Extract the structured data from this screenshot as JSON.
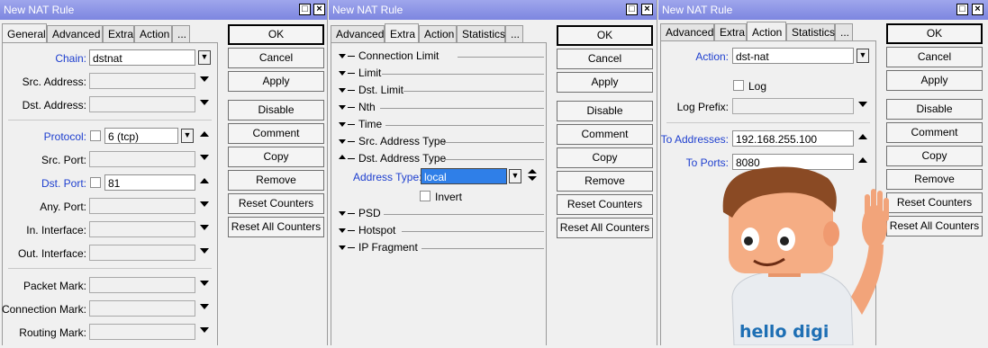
{
  "windows": [
    {
      "title": "New NAT Rule",
      "tabs": [
        "General",
        "Advanced",
        "Extra",
        "Action",
        "..."
      ],
      "active_tab": "General",
      "fields": {
        "chain": {
          "label": "Chain:",
          "value": "dstnat"
        },
        "src_address": {
          "label": "Src. Address:",
          "value": ""
        },
        "dst_address": {
          "label": "Dst. Address:",
          "value": ""
        },
        "protocol": {
          "label": "Protocol:",
          "value": "6 (tcp)"
        },
        "src_port": {
          "label": "Src. Port:",
          "value": ""
        },
        "dst_port": {
          "label": "Dst. Port:",
          "value": "81"
        },
        "any_port": {
          "label": "Any. Port:",
          "value": ""
        },
        "in_interface": {
          "label": "In. Interface:",
          "value": ""
        },
        "out_interface": {
          "label": "Out. Interface:",
          "value": ""
        },
        "packet_mark": {
          "label": "Packet Mark:",
          "value": ""
        },
        "connection_mark": {
          "label": "Connection Mark:",
          "value": ""
        },
        "routing_mark": {
          "label": "Routing Mark:",
          "value": ""
        }
      }
    },
    {
      "title": "New NAT Rule",
      "tabs": [
        "Advanced",
        "Extra",
        "Action",
        "Statistics",
        "..."
      ],
      "active_tab": "Extra",
      "sections": [
        "Connection Limit",
        "Limit",
        "Dst. Limit",
        "Nth",
        "Time",
        "Src. Address Type",
        "Dst. Address Type",
        "PSD",
        "Hotspot",
        "IP Fragment"
      ],
      "address_type": {
        "label": "Address Type:",
        "value": "local"
      },
      "invert_label": "Invert"
    },
    {
      "title": "New NAT Rule",
      "tabs": [
        "Advanced",
        "Extra",
        "Action",
        "Statistics",
        "..."
      ],
      "active_tab": "Action",
      "action": {
        "label": "Action:",
        "value": "dst-nat"
      },
      "log_label": "Log",
      "log_prefix": {
        "label": "Log Prefix:",
        "value": ""
      },
      "to_addresses": {
        "label": "To Addresses:",
        "value": "192.168.255.100"
      },
      "to_ports": {
        "label": "To Ports:",
        "value": "8080"
      }
    }
  ],
  "buttons": [
    "OK",
    "Cancel",
    "Apply",
    "Disable",
    "Comment",
    "Copy",
    "Remove",
    "Reset Counters",
    "Reset All Counters"
  ],
  "mascot_text": "hello digi",
  "colors": {
    "titlebar": "#8a92e6",
    "label_blue": "#1e3fcf",
    "selection": "#2f7fe8"
  }
}
